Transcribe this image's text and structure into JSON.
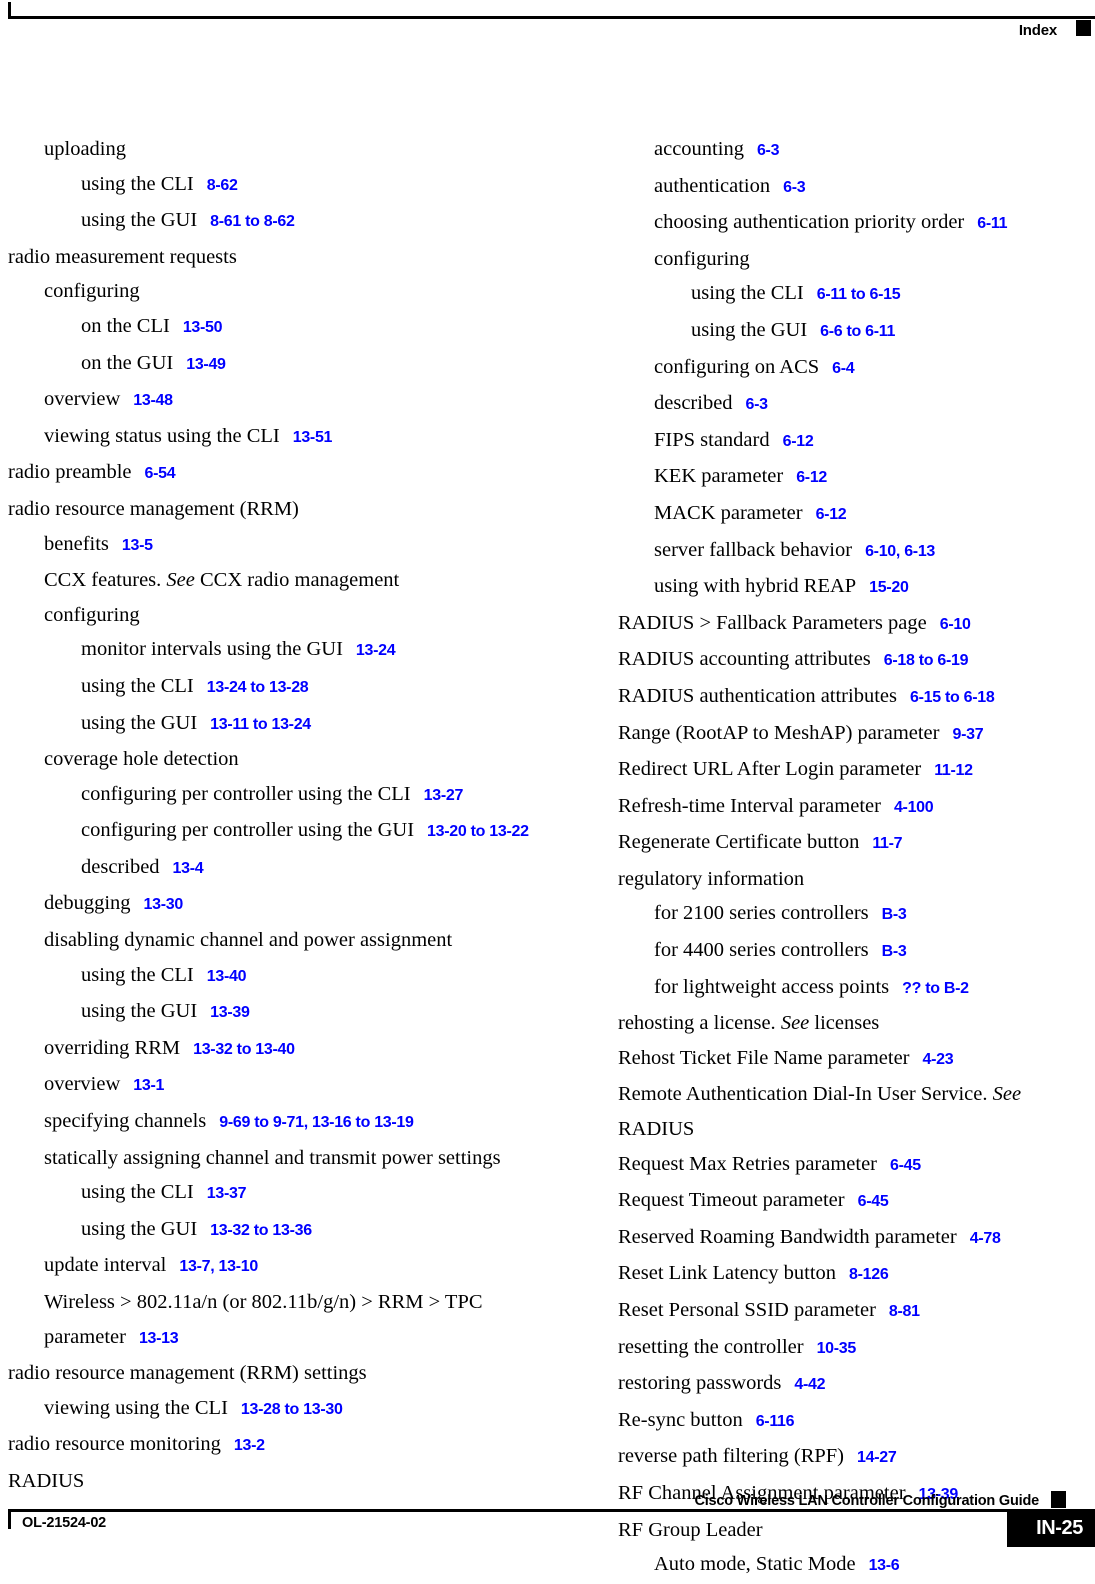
{
  "header": {
    "title": "Index"
  },
  "footer": {
    "guide_title": "Cisco Wireless LAN Controller Configuration Guide",
    "doc_id": "OL-21524-02",
    "page_number": "IN-25"
  },
  "index": {
    "left_column": [
      {
        "level": 1,
        "text": "uploading",
        "ref": ""
      },
      {
        "level": 2,
        "text": "using the CLI",
        "ref": "8-62"
      },
      {
        "level": 2,
        "text": "using the GUI",
        "ref": "8-61 to 8-62"
      },
      {
        "level": 0,
        "text": "radio measurement requests",
        "ref": ""
      },
      {
        "level": 1,
        "text": "configuring",
        "ref": ""
      },
      {
        "level": 2,
        "text": "on the CLI",
        "ref": "13-50"
      },
      {
        "level": 2,
        "text": "on the GUI",
        "ref": "13-49"
      },
      {
        "level": 1,
        "text": "overview",
        "ref": "13-48"
      },
      {
        "level": 1,
        "text": "viewing status using the CLI",
        "ref": "13-51"
      },
      {
        "level": 0,
        "text": "radio preamble",
        "ref": "6-54"
      },
      {
        "level": 0,
        "text": "radio resource management (RRM)",
        "ref": ""
      },
      {
        "level": 1,
        "text": "benefits",
        "ref": "13-5"
      },
      {
        "level": 1,
        "text": "CCX features. ",
        "see": "See",
        "text_after": " CCX radio management",
        "ref": ""
      },
      {
        "level": 1,
        "text": "configuring",
        "ref": ""
      },
      {
        "level": 2,
        "text": "monitor intervals using the GUI",
        "ref": "13-24"
      },
      {
        "level": 2,
        "text": "using the CLI",
        "ref": "13-24 to 13-28"
      },
      {
        "level": 2,
        "text": "using the GUI",
        "ref": "13-11 to 13-24"
      },
      {
        "level": 1,
        "text": "coverage hole detection",
        "ref": ""
      },
      {
        "level": 2,
        "text": "configuring per controller using the CLI",
        "ref": "13-27"
      },
      {
        "level": 2,
        "text": "configuring per controller using the GUI",
        "ref": "13-20 to 13-22"
      },
      {
        "level": 2,
        "text": "described",
        "ref": "13-4"
      },
      {
        "level": 1,
        "text": "debugging",
        "ref": "13-30"
      },
      {
        "level": 1,
        "text": "disabling dynamic channel and power assignment",
        "ref": ""
      },
      {
        "level": 2,
        "text": "using the CLI",
        "ref": "13-40"
      },
      {
        "level": 2,
        "text": "using the GUI",
        "ref": "13-39"
      },
      {
        "level": 1,
        "text": "overriding RRM",
        "ref": "13-32 to 13-40"
      },
      {
        "level": 1,
        "text": "overview",
        "ref": "13-1"
      },
      {
        "level": 1,
        "text": "specifying channels",
        "ref": "9-69 to 9-71, 13-16 to 13-19"
      },
      {
        "level": 1,
        "text": "statically assigning channel and transmit power settings",
        "ref": ""
      },
      {
        "level": 2,
        "text": "using the CLI",
        "ref": "13-37"
      },
      {
        "level": 2,
        "text": "using the GUI",
        "ref": "13-32 to 13-36"
      },
      {
        "level": 1,
        "text": "update interval",
        "ref": "13-7, 13-10"
      },
      {
        "level": 1,
        "text": "Wireless > 802.11a/n (or 802.11b/g/n) > RRM > TPC parameter",
        "ref": "13-13"
      },
      {
        "level": 0,
        "text": "radio resource management (RRM) settings",
        "ref": ""
      },
      {
        "level": 1,
        "text": "viewing using the CLI",
        "ref": "13-28 to 13-30"
      },
      {
        "level": 0,
        "text": "radio resource monitoring",
        "ref": "13-2"
      },
      {
        "level": 0,
        "text": "RADIUS",
        "ref": ""
      }
    ],
    "right_column": [
      {
        "level": 1,
        "text": "accounting",
        "ref": "6-3"
      },
      {
        "level": 1,
        "text": "authentication",
        "ref": "6-3"
      },
      {
        "level": 1,
        "text": "choosing authentication priority order",
        "ref": "6-11"
      },
      {
        "level": 1,
        "text": "configuring",
        "ref": ""
      },
      {
        "level": 2,
        "text": "using the CLI",
        "ref": "6-11 to 6-15"
      },
      {
        "level": 2,
        "text": "using the GUI",
        "ref": "6-6 to 6-11"
      },
      {
        "level": 1,
        "text": "configuring on ACS",
        "ref": "6-4"
      },
      {
        "level": 1,
        "text": "described",
        "ref": "6-3"
      },
      {
        "level": 1,
        "text": "FIPS standard",
        "ref": "6-12"
      },
      {
        "level": 1,
        "text": "KEK parameter",
        "ref": "6-12"
      },
      {
        "level": 1,
        "text": "MACK parameter",
        "ref": "6-12"
      },
      {
        "level": 1,
        "text": "server fallback behavior",
        "ref": "6-10, 6-13"
      },
      {
        "level": 1,
        "text": "using with hybrid REAP",
        "ref": "15-20"
      },
      {
        "level": 0,
        "text": "RADIUS > Fallback Parameters page",
        "ref": "6-10"
      },
      {
        "level": 0,
        "text": "RADIUS accounting attributes",
        "ref": "6-18 to 6-19"
      },
      {
        "level": 0,
        "text": "RADIUS authentication attributes",
        "ref": "6-15 to 6-18"
      },
      {
        "level": 0,
        "text": "Range (RootAP to MeshAP) parameter",
        "ref": "9-37"
      },
      {
        "level": 0,
        "text": "Redirect URL After Login parameter",
        "ref": "11-12"
      },
      {
        "level": 0,
        "text": "Refresh-time Interval parameter",
        "ref": "4-100"
      },
      {
        "level": 0,
        "text": "Regenerate Certificate button",
        "ref": "11-7"
      },
      {
        "level": 0,
        "text": "regulatory information",
        "ref": ""
      },
      {
        "level": 1,
        "text": "for 2100 series controllers",
        "ref": "B-3"
      },
      {
        "level": 1,
        "text": "for 4400 series controllers",
        "ref": "B-3"
      },
      {
        "level": 1,
        "text": "for lightweight access points",
        "ref": "?? to B-2"
      },
      {
        "level": 0,
        "text": "rehosting a license. ",
        "see": "See",
        "text_after": " licenses",
        "ref": ""
      },
      {
        "level": 0,
        "text": "Rehost Ticket File Name parameter",
        "ref": "4-23"
      },
      {
        "level": 0,
        "text": "Remote Authentication Dial-In User Service. ",
        "see": "See",
        "text_after": " RADIUS",
        "ref": ""
      },
      {
        "level": 0,
        "text": "Request Max Retries parameter",
        "ref": "6-45"
      },
      {
        "level": 0,
        "text": "Request Timeout parameter",
        "ref": "6-45"
      },
      {
        "level": 0,
        "text": "Reserved Roaming Bandwidth parameter",
        "ref": "4-78"
      },
      {
        "level": 0,
        "text": "Reset Link Latency button",
        "ref": "8-126"
      },
      {
        "level": 0,
        "text": "Reset Personal SSID parameter",
        "ref": "8-81"
      },
      {
        "level": 0,
        "text": "resetting the controller",
        "ref": "10-35"
      },
      {
        "level": 0,
        "text": "restoring passwords",
        "ref": "4-42"
      },
      {
        "level": 0,
        "text": "Re-sync button",
        "ref": "6-116"
      },
      {
        "level": 0,
        "text": "reverse path filtering (RPF)",
        "ref": "14-27"
      },
      {
        "level": 0,
        "text": "RF Channel Assignment parameter",
        "ref": "13-39"
      },
      {
        "level": 0,
        "text": "RF Group Leader",
        "ref": ""
      },
      {
        "level": 1,
        "text": "Auto mode, Static Mode",
        "ref": "13-6"
      }
    ]
  }
}
